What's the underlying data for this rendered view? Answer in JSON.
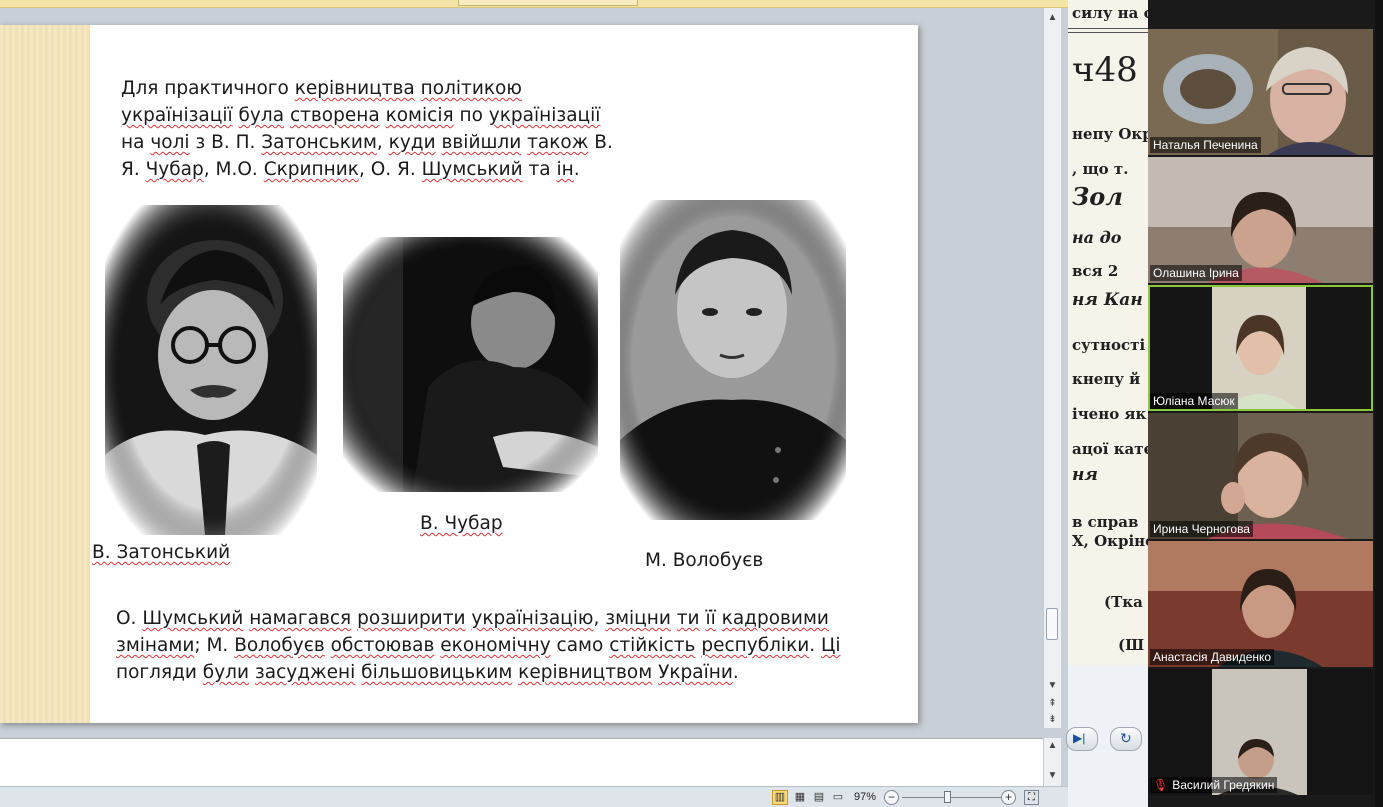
{
  "slide": {
    "paragraph_top": [
      {
        "parts": [
          {
            "t": "Для практичного "
          },
          {
            "t": "керівництва",
            "sq": true
          },
          {
            "t": " "
          },
          {
            "t": "політикою",
            "sq": true
          }
        ]
      },
      {
        "parts": [
          {
            "t": "українізації",
            "sq": true
          },
          {
            "t": " "
          },
          {
            "t": "була",
            "sq": true
          },
          {
            "t": " "
          },
          {
            "t": "створена",
            "sq": true
          },
          {
            "t": " "
          },
          {
            "t": "комісія",
            "sq": true
          },
          {
            "t": " по "
          },
          {
            "t": "українізації",
            "sq": true
          }
        ]
      },
      {
        "parts": [
          {
            "t": "на "
          },
          {
            "t": "чолі",
            "sq": true
          },
          {
            "t": " з В. П. "
          },
          {
            "t": "Затонським",
            "sq": true
          },
          {
            "t": ", "
          },
          {
            "t": "куди",
            "sq": true
          },
          {
            "t": " "
          },
          {
            "t": "ввійшли",
            "sq": true
          },
          {
            "t": " "
          },
          {
            "t": "також",
            "sq": true
          },
          {
            "t": " В."
          }
        ]
      },
      {
        "parts": [
          {
            "t": "Я. "
          },
          {
            "t": "Чубар",
            "sq": true
          },
          {
            "t": ", М.О. "
          },
          {
            "t": "Скрипник",
            "sq": true
          },
          {
            "t": ", О. Я. "
          },
          {
            "t": "Шумський",
            "sq": true
          },
          {
            "t": " та "
          },
          {
            "t": "ін",
            "sq": true
          },
          {
            "t": "."
          }
        ]
      }
    ],
    "captions": {
      "zatonsky": "В.  Затонський",
      "chubar": "В. Чубар",
      "volobuev": "М. Волобуєв"
    },
    "paragraph_bottom": [
      {
        "parts": [
          {
            "t": "О. "
          },
          {
            "t": "Шумський",
            "sq": true
          },
          {
            "t": " "
          },
          {
            "t": "намагався",
            "sq": true
          },
          {
            "t": " "
          },
          {
            "t": "розширити",
            "sq": true
          },
          {
            "t": " "
          },
          {
            "t": "українізацію",
            "sq": true
          },
          {
            "t": ",  "
          },
          {
            "t": "зміцни",
            "sq": true
          },
          {
            "t": " "
          },
          {
            "t": "ти",
            "sq": true
          },
          {
            "t": " "
          },
          {
            "t": "її",
            "sq": true
          },
          {
            "t": " "
          },
          {
            "t": "кадровими",
            "sq": true
          }
        ]
      },
      {
        "parts": [
          {
            "t": "змінами",
            "sq": true
          },
          {
            "t": "; М. "
          },
          {
            "t": "Волобуєв",
            "sq": true
          },
          {
            "t": " "
          },
          {
            "t": "обстоював",
            "sq": true
          },
          {
            "t": " "
          },
          {
            "t": "економічну",
            "sq": true
          },
          {
            "t": "  само "
          },
          {
            "t": "стійкість",
            "sq": true
          },
          {
            "t": " "
          },
          {
            "t": "республіки",
            "sq": true
          },
          {
            "t": ".  "
          },
          {
            "t": "Ці",
            "sq": true
          }
        ]
      },
      {
        "parts": [
          {
            "t": "погляди "
          },
          {
            "t": "були",
            "sq": true
          },
          {
            "t": " "
          },
          {
            "t": "засуджені",
            "sq": true
          },
          {
            "t": "  "
          },
          {
            "t": "більшовицьким",
            "sq": true
          },
          {
            "t": " "
          },
          {
            "t": "керівництвом",
            "sq": true
          },
          {
            "t": " "
          },
          {
            "t": "України",
            "sq": true
          },
          {
            "t": "."
          }
        ]
      }
    ]
  },
  "statusbar": {
    "zoom": "97%"
  },
  "document_bg": {
    "lines": [
      "силу на один рік.",
      "ч48",
      "непу Окр",
      ", що т.",
      "Зол",
      "на до",
      "вся 2",
      "ня Кан",
      "сутності",
      "кнепу й",
      "ічено як",
      "ацої кате",
      "ня",
      "в справ",
      "Х, Окріне",
      "(Тка",
      "(Ш"
    ]
  },
  "participants": [
    {
      "name": "Наталья Печенина",
      "muted": false
    },
    {
      "name": "Олашина Ірина",
      "muted": false
    },
    {
      "name": "Юліана Масюк",
      "muted": false,
      "active": true
    },
    {
      "name": "Ирина Черногова",
      "muted": false
    },
    {
      "name": "Анастасія Давиденко",
      "muted": false
    },
    {
      "name": "Василий Гредякин",
      "muted": true
    }
  ],
  "colors": {
    "active_speaker_border": "#8ac83a",
    "spellcheck_underline": "#dd3333",
    "slide_stripe": "#f6e7c3"
  }
}
